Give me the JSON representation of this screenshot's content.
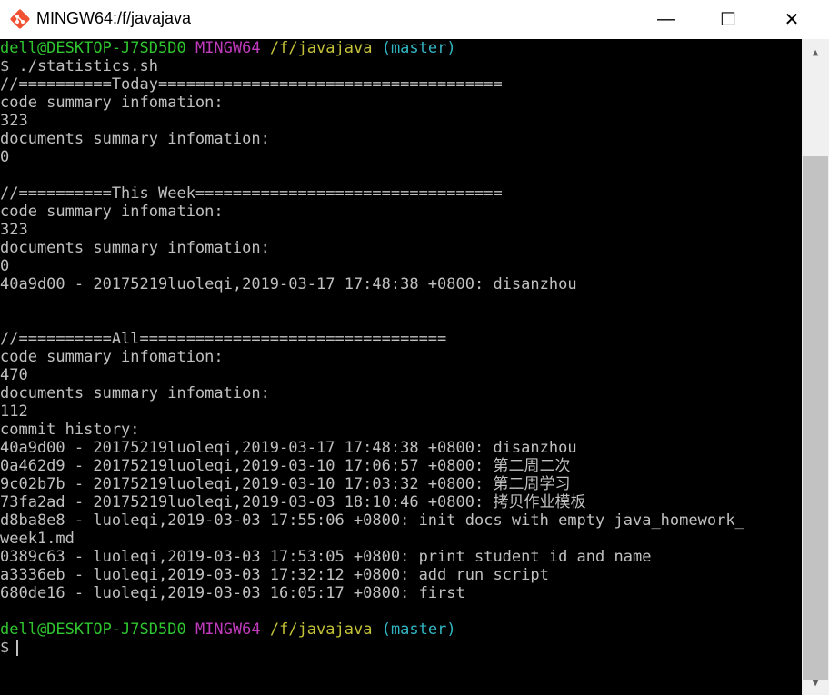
{
  "window": {
    "title": "MINGW64:/f/javajava",
    "minimize": "—",
    "maximize": "☐",
    "close": "✕"
  },
  "prompt": {
    "user": "dell@DESKTOP-J7SD5D0",
    "host": "MINGW64",
    "path": "/f/javajava",
    "branch": "(master)",
    "symbol": "$"
  },
  "terminal": {
    "command": "$ ./statistics.sh",
    "lines": [
      "//==========Today=====================================",
      "code summary infomation:",
      "323",
      "documents summary infomation:",
      "0",
      "",
      "//==========This Week=================================",
      "code summary infomation:",
      "323",
      "documents summary infomation:",
      "0",
      "40a9d00 - 20175219luoleqi,2019-03-17 17:48:38 +0800: disanzhou",
      "",
      "",
      "//==========All=================================",
      "code summary infomation:",
      "470",
      "documents summary infomation:",
      "112",
      "commit history:",
      "40a9d00 - 20175219luoleqi,2019-03-17 17:48:38 +0800: disanzhou",
      "0a462d9 - 20175219luoleqi,2019-03-10 17:06:57 +0800: 第二周二次",
      "9c02b7b - 20175219luoleqi,2019-03-10 17:03:32 +0800: 第二周学习",
      "73fa2ad - 20175219luoleqi,2019-03-03 18:10:46 +0800: 拷贝作业模板",
      "d8ba8e8 - luoleqi,2019-03-03 17:55:06 +0800: init docs with empty java_homework_",
      "week1.md",
      "0389c63 - luoleqi,2019-03-03 17:53:05 +0800: print student id and name",
      "a3336eb - luoleqi,2019-03-03 17:32:12 +0800: add run script",
      "680de16 - luoleqi,2019-03-03 16:05:17 +0800: first",
      ""
    ]
  },
  "colors": {
    "background": "#000000",
    "text": "#c0c0c0",
    "user": "#2fc52f",
    "host": "#c13bbd",
    "path": "#c4c238",
    "branch": "#32b6c3"
  }
}
